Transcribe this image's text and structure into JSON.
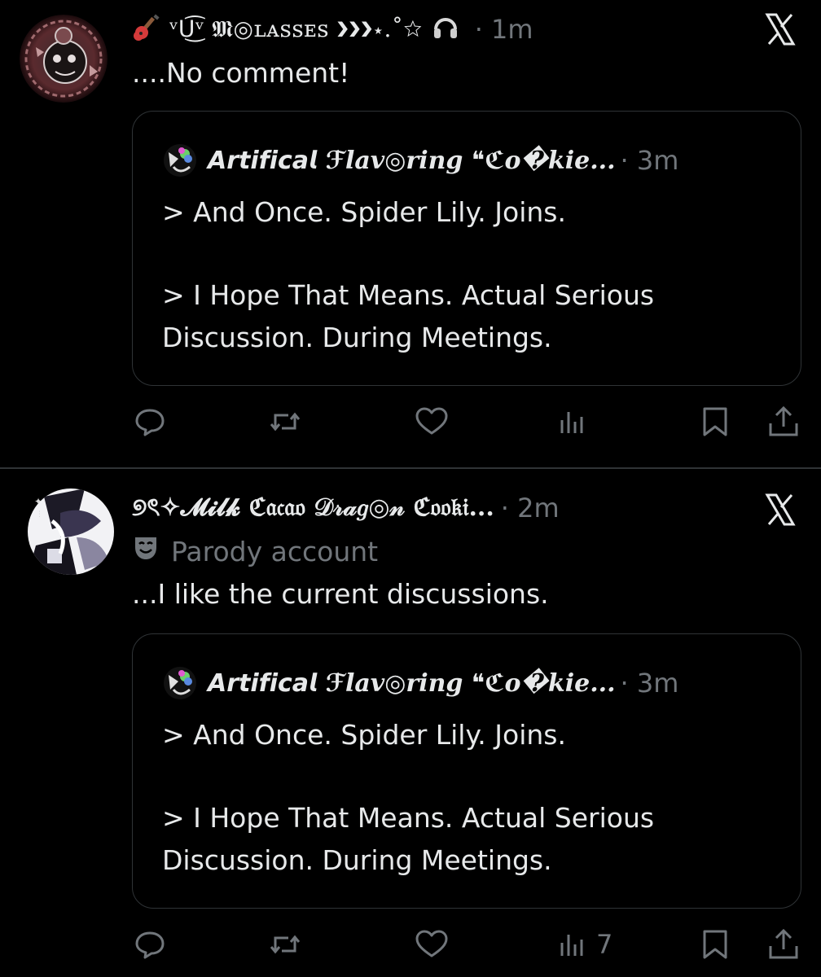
{
  "posts": [
    {
      "display_name": "ᵛᑌ͜͡ᵛ 𝕸◎ʟᴀꜱꜱᴇꜱ ❯❯❯⋆.˚☆",
      "time": "· 1m",
      "text": "....No comment!",
      "leading_emoji": "guitar-icon",
      "trailing_emoji": "headphones-icon",
      "quote": {
        "display_name": "𝘼𝙧𝙩𝙞𝙛𝙞𝙘𝙖𝙡 ℱlav◎ring ❝ℭo�kie...",
        "time": "· 3m",
        "line1": "> And Once. Spider Lily. Joins.",
        "line2": "> I Hope That Means. Actual Serious",
        "line3": "Discussion. During Meetings."
      },
      "views": ""
    },
    {
      "display_name": "୭ৎ✧𝓜𝓲𝓵𝓴 ℭ𝔞𝔠𝔞𝔬 𝒟𝓇𝒶𝑔◎𝓃 ℭ𝔬𝔬𝔨𝔦...",
      "time": "· 2m",
      "parody_label": "Parody account",
      "text": "...I like the current discussions.",
      "quote": {
        "display_name": "𝘼𝙧𝙩𝙞𝙛𝙞𝙘𝙖𝙡 ℱlav◎ring ❝ℭo�kie...",
        "time": "· 3m",
        "line1": "> And Once. Spider Lily. Joins.",
        "line2": "> I Hope That Means. Actual Serious",
        "line3": "Discussion. During Meetings."
      },
      "views": "7"
    }
  ],
  "colors": {
    "background": "#000000",
    "text": "#e7e9ea",
    "muted": "#71767b",
    "border": "#2f3336"
  }
}
